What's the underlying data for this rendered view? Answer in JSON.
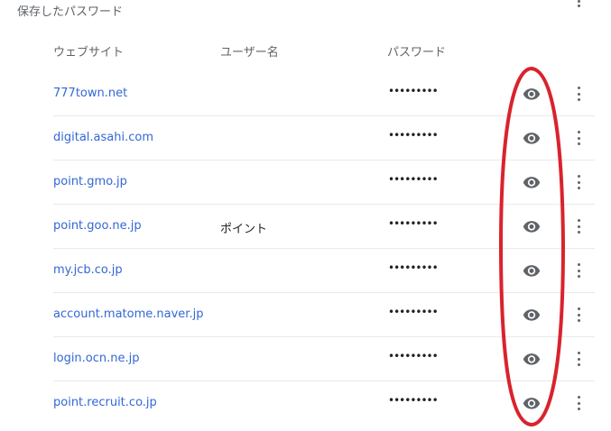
{
  "section": {
    "title": "保存したパスワード"
  },
  "columns": {
    "site": "ウェブサイト",
    "user": "ユーザー名",
    "password": "パスワード"
  },
  "rows": [
    {
      "site": "777town.net",
      "user": "",
      "password": "•••••••••"
    },
    {
      "site": "digital.asahi.com",
      "user": "",
      "password": "•••••••••"
    },
    {
      "site": "point.gmo.jp",
      "user": "",
      "password": "•••••••••"
    },
    {
      "site": "point.goo.ne.jp",
      "user": "ポイント",
      "password": "•••••••••"
    },
    {
      "site": "my.jcb.co.jp",
      "user": "",
      "password": "•••••••••"
    },
    {
      "site": "account.matome.naver.jp",
      "user": "",
      "password": "•••••••••"
    },
    {
      "site": "login.ocn.ne.jp",
      "user": "",
      "password": "•••••••••"
    },
    {
      "site": "point.recruit.co.jp",
      "user": "",
      "password": "•••••••••"
    }
  ],
  "icons": {
    "show_password": "eye-icon",
    "more": "more-vert-icon"
  },
  "colors": {
    "link": "#3367d6",
    "annotation": "#d9232d",
    "icon": "#5f6368"
  }
}
